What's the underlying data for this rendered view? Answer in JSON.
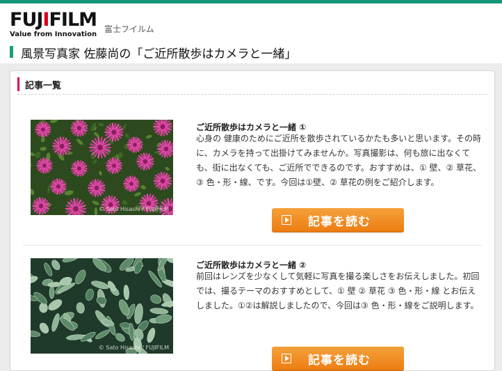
{
  "brand": {
    "logo_text": "FUJIFILM",
    "tagline": "Value from Innovation",
    "kana": "富士フイルム"
  },
  "page_title": "風景写真家 佐藤尚の「ご近所散歩はカメラと一緒」",
  "list_heading": "記事一覧",
  "articles": [
    {
      "title": "ご近所散歩はカメラと一緒 ①",
      "body": "心身の 健康のためにご近所を散歩されているかたも多いと思います。その時に、カメラを持って出掛けてみませんか。写真撮影は、何も旅に出なくても、街に出なくても、ご近所でできるのです。おすすめは、① 壁、② 草花、③ 色・形・線、です。今回は①壁、② 草花の例をご紹介します。",
      "button_label": "記事を読む",
      "image_subject": "pink daisy flowers",
      "watermark": "© Sato Hisashi / FUJIFILM"
    },
    {
      "title": "ご近所散歩はカメラと一緒 ②",
      "body": "前回はレンズを少なくして気軽に写真を撮る楽しさをお伝えしました。初回では、撮るテーマのおすすめとして、① 壁 ② 草花 ③ 色・形・線 とお伝えしました。①②は解説しましたので、今回は③ 色・形・線をご説明します。",
      "button_label": "記事を読む",
      "image_subject": "green leafy plant",
      "watermark": "© Sato Hisashi / FUJIFILM"
    }
  ],
  "colors": {
    "top_bar": "#15967a",
    "title_mark": "#19a06e",
    "heading_mark": "#e0004d",
    "button": "#ee8418",
    "logo_accent": "#d6001c"
  }
}
